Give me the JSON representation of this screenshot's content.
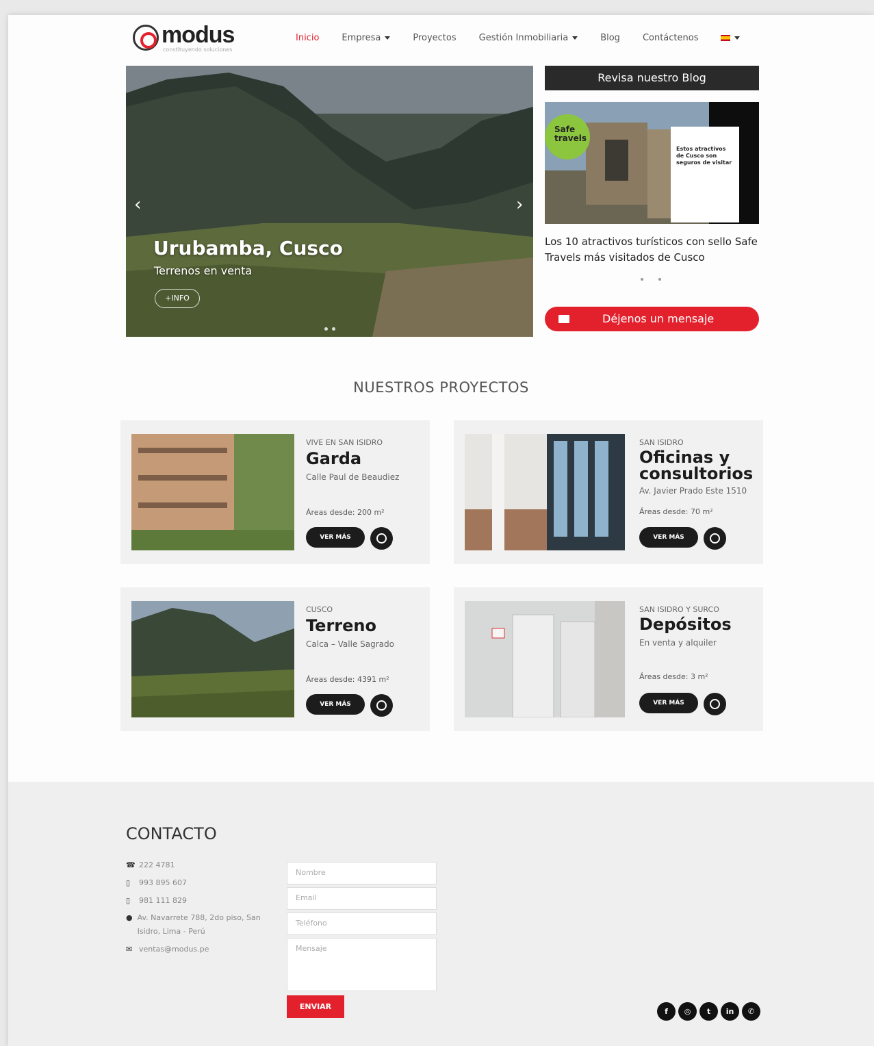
{
  "header": {
    "logo_text": "modus",
    "logo_tagline": "constituyendo soluciones",
    "nav": [
      {
        "label": "Inicio"
      },
      {
        "label": "Empresa"
      },
      {
        "label": "Proyectos"
      },
      {
        "label": "Gestión Inmobiliaria"
      },
      {
        "label": "Blog"
      },
      {
        "label": "Contáctenos"
      }
    ]
  },
  "hero": {
    "title": "Urubamba, Cusco",
    "subtitle": "Terrenos en venta",
    "button": "+INFO",
    "prev_icon": "‹",
    "next_icon": "›"
  },
  "blog": {
    "header": "Revisa nuestro Blog",
    "badge": "Safe travels",
    "card_text": "Estos atractivos de Cusco son seguros de visitar",
    "title": "Los 10 atractivos turísticos con sello Safe Travels más visitados de Cusco",
    "message_button": "Déjenos un mensaje"
  },
  "projects": {
    "title": "NUESTROS PROYECTOS",
    "items": [
      {
        "tag": "VIVE EN SAN ISIDRO",
        "name": "Garda",
        "address": "Calle Paul de Beaudiez",
        "area": "Áreas desde: 200 m²",
        "button": "VER MÁS"
      },
      {
        "tag": "SAN ISIDRO",
        "name": "Oficinas y consultorios",
        "address": "Av. Javier Prado Este 1510",
        "area": "Áreas desde: 70 m²",
        "button": "VER MÁS"
      },
      {
        "tag": "CUSCO",
        "name": "Terreno",
        "address": "Calca – Valle Sagrado",
        "area": "Áreas desde: 4391 m²",
        "button": "VER MÁS"
      },
      {
        "tag": "SAN ISIDRO Y SURCO",
        "name": "Depósitos",
        "address": "En venta y alquiler",
        "area": "Áreas desde: 3 m²",
        "button": "VER MÁS"
      }
    ]
  },
  "contact": {
    "title": "CONTACTO",
    "phone": "222 4781",
    "mobile1": "993 895 607",
    "mobile2": "981 111 829",
    "address": "Av. Navarrete 788, 2do piso, San Isidro, Lima - Perú",
    "email": "ventas@modus.pe",
    "form": {
      "name_placeholder": "Nombre",
      "email_placeholder": "Email",
      "phone_placeholder": "Teléfono",
      "message_placeholder": "Mensaje",
      "submit": "ENVIAR"
    },
    "socials": [
      "facebook-icon",
      "instagram-icon",
      "twitter-icon",
      "linkedin-icon",
      "whatsapp-icon"
    ]
  },
  "colors": {
    "accent": "#e3212d",
    "dark": "#1c1c1c"
  }
}
